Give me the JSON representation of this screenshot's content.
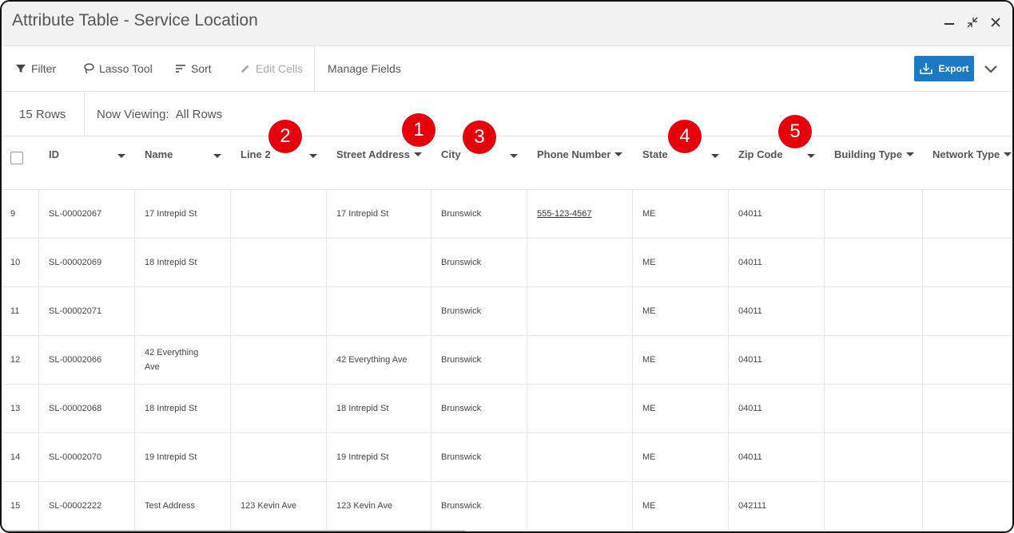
{
  "window": {
    "title": "Attribute Table - Service Location"
  },
  "toolbar": {
    "filter": "Filter",
    "lasso": "Lasso Tool",
    "sort": "Sort",
    "edit_cells": "Edit Cells",
    "manage_fields": "Manage Fields",
    "export": "Export"
  },
  "info": {
    "row_count": "15 Rows",
    "viewing_label": "Now Viewing:",
    "viewing_value": "All Rows"
  },
  "columns": [
    "ID",
    "Name",
    "Line 2",
    "Street Address",
    "City",
    "Phone Number",
    "State",
    "Zip Code",
    "Building Type",
    "Network Type"
  ],
  "badges": [
    "1",
    "2",
    "3",
    "4",
    "5"
  ],
  "rows": [
    {
      "num": "9",
      "id": "SL-00002067",
      "name": "17 Intrepid St",
      "line2": "",
      "street": "17 Intrepid St",
      "city": "Brunswick",
      "phone": "555-123-4567",
      "state": "ME",
      "zip": "04011",
      "building": "",
      "network": ""
    },
    {
      "num": "10",
      "id": "SL-00002069",
      "name": "18 Intrepid St",
      "line2": "",
      "street": "",
      "city": "Brunswick",
      "phone": "",
      "state": "ME",
      "zip": "04011",
      "building": "",
      "network": ""
    },
    {
      "num": "11",
      "id": "SL-00002071",
      "name": "",
      "line2": "",
      "street": "",
      "city": "Brunswick",
      "phone": "",
      "state": "ME",
      "zip": "04011",
      "building": "",
      "network": ""
    },
    {
      "num": "12",
      "id": "SL-00002066",
      "name": "42 Everything Ave",
      "line2": "",
      "street": "42 Everything Ave",
      "city": "Brunswick",
      "phone": "",
      "state": "ME",
      "zip": "04011",
      "building": "",
      "network": ""
    },
    {
      "num": "13",
      "id": "SL-00002068",
      "name": "18 Intrepid St",
      "line2": "",
      "street": "18 Intrepid St",
      "city": "Brunswick",
      "phone": "",
      "state": "ME",
      "zip": "04011",
      "building": "",
      "network": ""
    },
    {
      "num": "14",
      "id": "SL-00002070",
      "name": "19 Intrepid St",
      "line2": "",
      "street": "19 Intrepid St",
      "city": "Brunswick",
      "phone": "",
      "state": "ME",
      "zip": "04011",
      "building": "",
      "network": ""
    },
    {
      "num": "15",
      "id": "SL-00002222",
      "name": "Test Address",
      "line2": "123 Kevin Ave",
      "street": "123 Kevin Ave",
      "city": "Brunswick",
      "phone": "",
      "state": "ME",
      "zip": "042111",
      "building": "",
      "network": ""
    }
  ],
  "colors": {
    "export_button": "#1c7ac4",
    "badge": "#e6000b",
    "titlebar": "#f2f2f2"
  }
}
